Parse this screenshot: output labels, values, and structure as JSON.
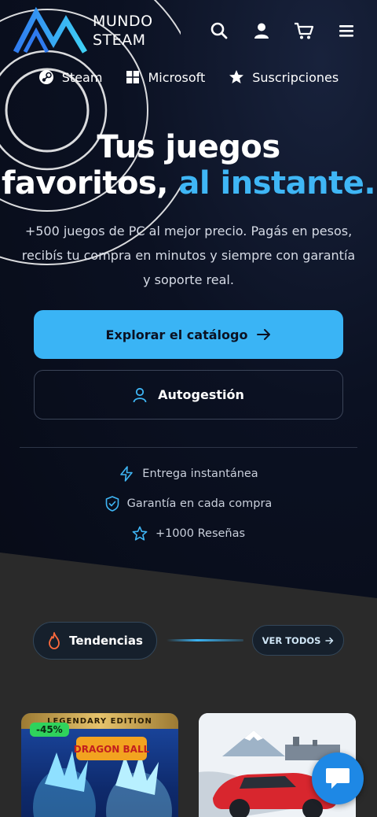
{
  "brand": {
    "line1": "MUNDO",
    "line2": "STEAM"
  },
  "header_icons": [
    "search-icon",
    "user-icon",
    "cart-icon",
    "menu-icon"
  ],
  "nav": [
    {
      "label": "Steam",
      "icon": "steam-icon"
    },
    {
      "label": "Microsoft",
      "icon": "windows-icon"
    },
    {
      "label": "Suscripciones",
      "icon": "star-icon"
    }
  ],
  "hero": {
    "title_line1": "Tus juegos",
    "title_line2_plain": "favoritos,",
    "title_line2_accent": "al instante.",
    "subtitle": "+500 juegos de PC al mejor precio. Pagás en pesos, recibís tu compra en minutos y siempre con garantía y soporte real.",
    "primary_button": "Explorar el catálogo",
    "secondary_button": "Autogestión"
  },
  "features": [
    {
      "label": "Entrega instantánea",
      "icon": "bolt-icon"
    },
    {
      "label": "Garantía en cada compra",
      "icon": "shield-check-icon"
    },
    {
      "label": "+1000 Reseñas",
      "icon": "star-outline-icon"
    }
  ],
  "trends": {
    "label": "Tendencias",
    "see_all": "VER TODOS"
  },
  "products": [
    {
      "edition": "LEGENDARY EDITION",
      "discount": "-45%",
      "cover_text": "DRAGON BALL Sparking! ZERO"
    },
    {
      "cover": "car-cover"
    }
  ],
  "colors": {
    "accent": "#3fb6f5",
    "primary_button": "#3ab4f5",
    "discount": "#2fd35c",
    "chat": "#1e88e5"
  }
}
